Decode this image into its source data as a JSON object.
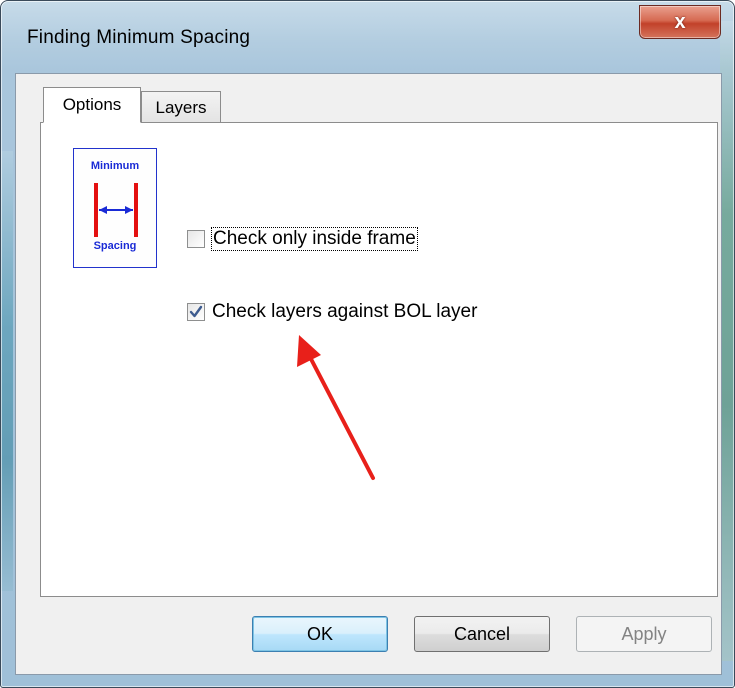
{
  "window": {
    "title": "Finding Minimum Spacing",
    "close_glyph": "x"
  },
  "tabs": [
    {
      "label": "Options",
      "selected": true
    },
    {
      "label": "Layers",
      "selected": false
    }
  ],
  "emblem": {
    "top_text": "Minimum",
    "bottom_text": "Spacing",
    "icon": "minimum-spacing-icon",
    "colors": {
      "text": "#1a2bd6",
      "bars": "#e41010",
      "arrow": "#1a2bd6"
    }
  },
  "options": [
    {
      "label": "Check only inside frame",
      "checked": false
    },
    {
      "label": "Check layers against BOL layer",
      "checked": true
    }
  ],
  "annotation": {
    "color": "#e8201a"
  },
  "buttons": {
    "ok": "OK",
    "cancel": "Cancel",
    "apply": "Apply",
    "apply_enabled": false
  }
}
